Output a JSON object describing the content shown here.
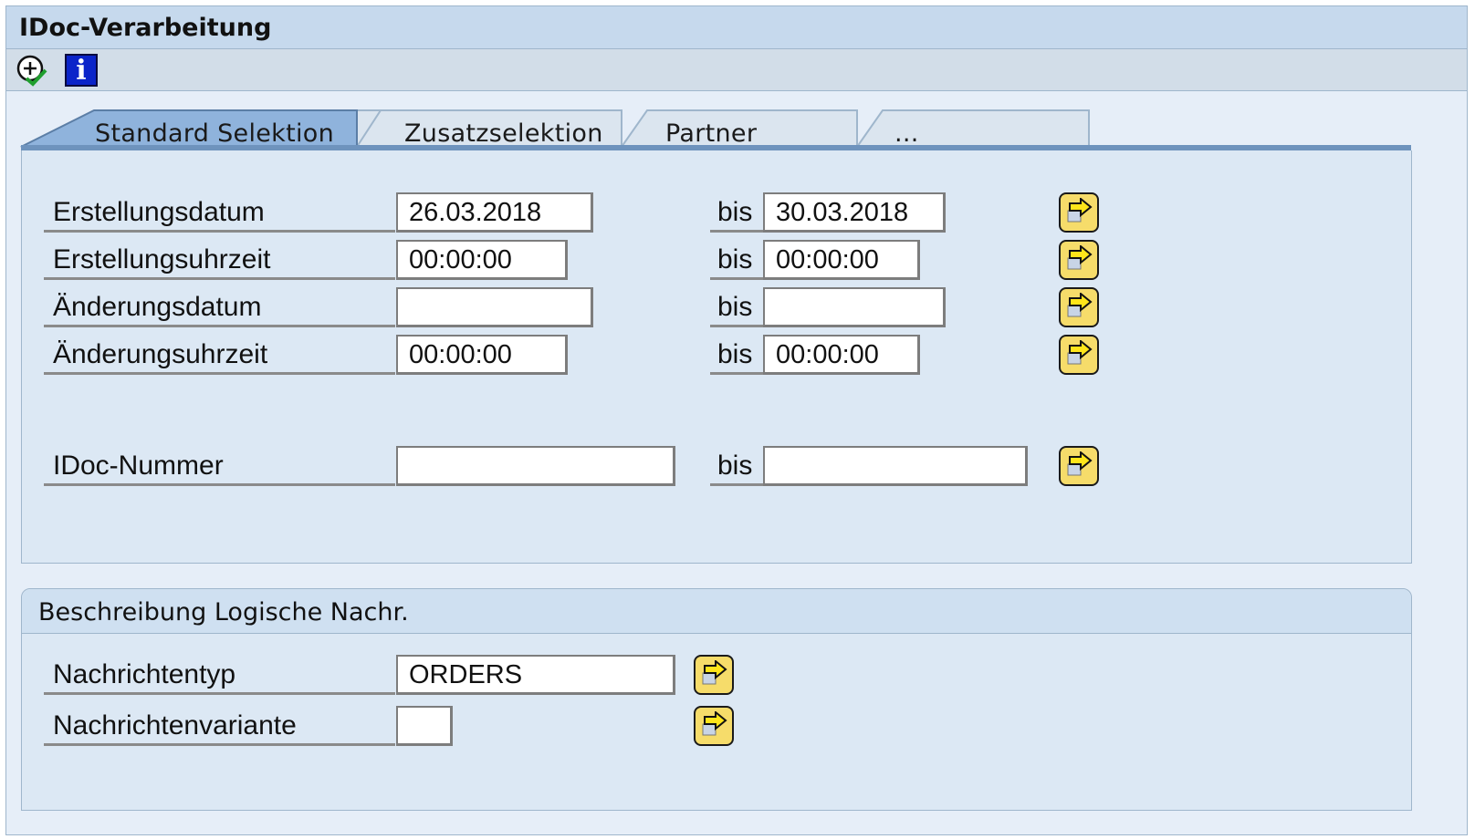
{
  "window": {
    "title": "IDoc-Verarbeitung"
  },
  "toolbar": {
    "execute_icon": "execute-icon",
    "info_icon": "info-icon",
    "info_glyph": "i"
  },
  "tabs": [
    {
      "label": "Standard Selektion",
      "active": true
    },
    {
      "label": "Zusatzselektion",
      "active": false
    },
    {
      "label": "Partner",
      "active": false
    },
    {
      "label": "...",
      "active": false
    }
  ],
  "selection": {
    "bis_label": "bis",
    "rows": [
      {
        "label": "Erstellungsdatum",
        "from": "26.03.2018",
        "to": "30.03.2018"
      },
      {
        "label": "Erstellungsuhrzeit",
        "from": "00:00:00",
        "to": "00:00:00"
      },
      {
        "label": "Änderungsdatum",
        "from": "",
        "to": ""
      },
      {
        "label": "Änderungsuhrzeit",
        "from": "00:00:00",
        "to": "00:00:00"
      },
      {
        "label": "IDoc-Nummer",
        "from": "",
        "to": ""
      }
    ]
  },
  "message_group": {
    "title": "Beschreibung Logische Nachr.",
    "rows": [
      {
        "label": "Nachrichtentyp",
        "value": "ORDERS"
      },
      {
        "label": "Nachrichtenvariante",
        "value": ""
      }
    ]
  },
  "colors": {
    "arrow_button": "#f6dc6a",
    "active_tab": "#8fb3dc",
    "panel": "#dce8f4"
  }
}
